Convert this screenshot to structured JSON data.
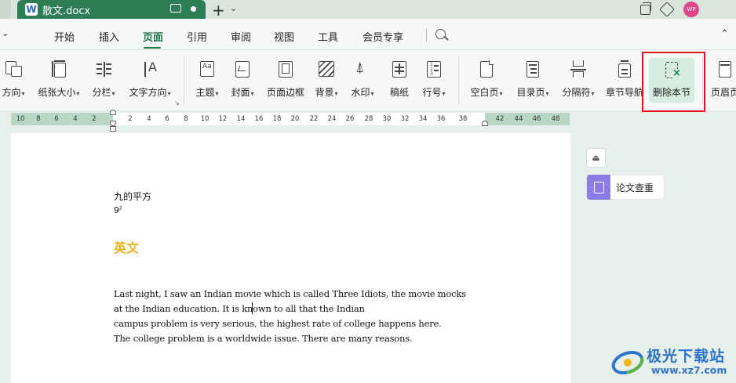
{
  "window": {
    "doc_tab": {
      "app_letter": "W",
      "name": "散文.docx"
    }
  },
  "menu": {
    "items": [
      "开始",
      "插入",
      "页面",
      "引用",
      "审阅",
      "视图",
      "工具",
      "会员专享"
    ],
    "active": "页面"
  },
  "ribbon": {
    "buttons": [
      {
        "label": "方向",
        "dropdown": true
      },
      {
        "label": "纸张大小",
        "dropdown": true
      },
      {
        "label": "分栏",
        "dropdown": true
      },
      {
        "label": "文字方向",
        "dropdown": true
      },
      {
        "label": "主题",
        "dropdown": true
      },
      {
        "label": "封面",
        "dropdown": true
      },
      {
        "label": "页面边框",
        "dropdown": false
      },
      {
        "label": "背景",
        "dropdown": true
      },
      {
        "label": "水印",
        "dropdown": true
      },
      {
        "label": "稿纸",
        "dropdown": false
      },
      {
        "label": "行号",
        "dropdown": true
      },
      {
        "label": "空白页",
        "dropdown": true
      },
      {
        "label": "目录页",
        "dropdown": true
      },
      {
        "label": "分隔符",
        "dropdown": true
      },
      {
        "label": "章节导航",
        "dropdown": false
      },
      {
        "label": "删除本节",
        "dropdown": false
      },
      {
        "label": "页眉页",
        "dropdown": false
      }
    ],
    "highlight_color": "#d9141c"
  },
  "ruler": {
    "ticks": [
      "10",
      "8",
      "6",
      "4",
      "2",
      "2",
      "4",
      "6",
      "8",
      "10",
      "12",
      "14",
      "16",
      "18",
      "20",
      "22",
      "24",
      "26",
      "28",
      "30",
      "32",
      "34",
      "36",
      "38",
      "42",
      "44",
      "46",
      "48"
    ]
  },
  "document": {
    "line1": "九的平方",
    "line2": "9",
    "line2_sup": "2",
    "heading": "英文",
    "heading_color": "#e6b21e",
    "paragraph": [
      "Last night, I saw an Indian movie which is called Three Idiots, the movie mocks",
      "at the Indian education. It is known to all that the Indian",
      "campus problem is very serious, the highest rate of college happens here.",
      "The college problem is a worldwide issue. There are many reasons."
    ]
  },
  "side_panel": {
    "paper_check_label": "论文查重"
  },
  "watermark": {
    "text": "极光下载站",
    "url": "www.xz7.com"
  }
}
